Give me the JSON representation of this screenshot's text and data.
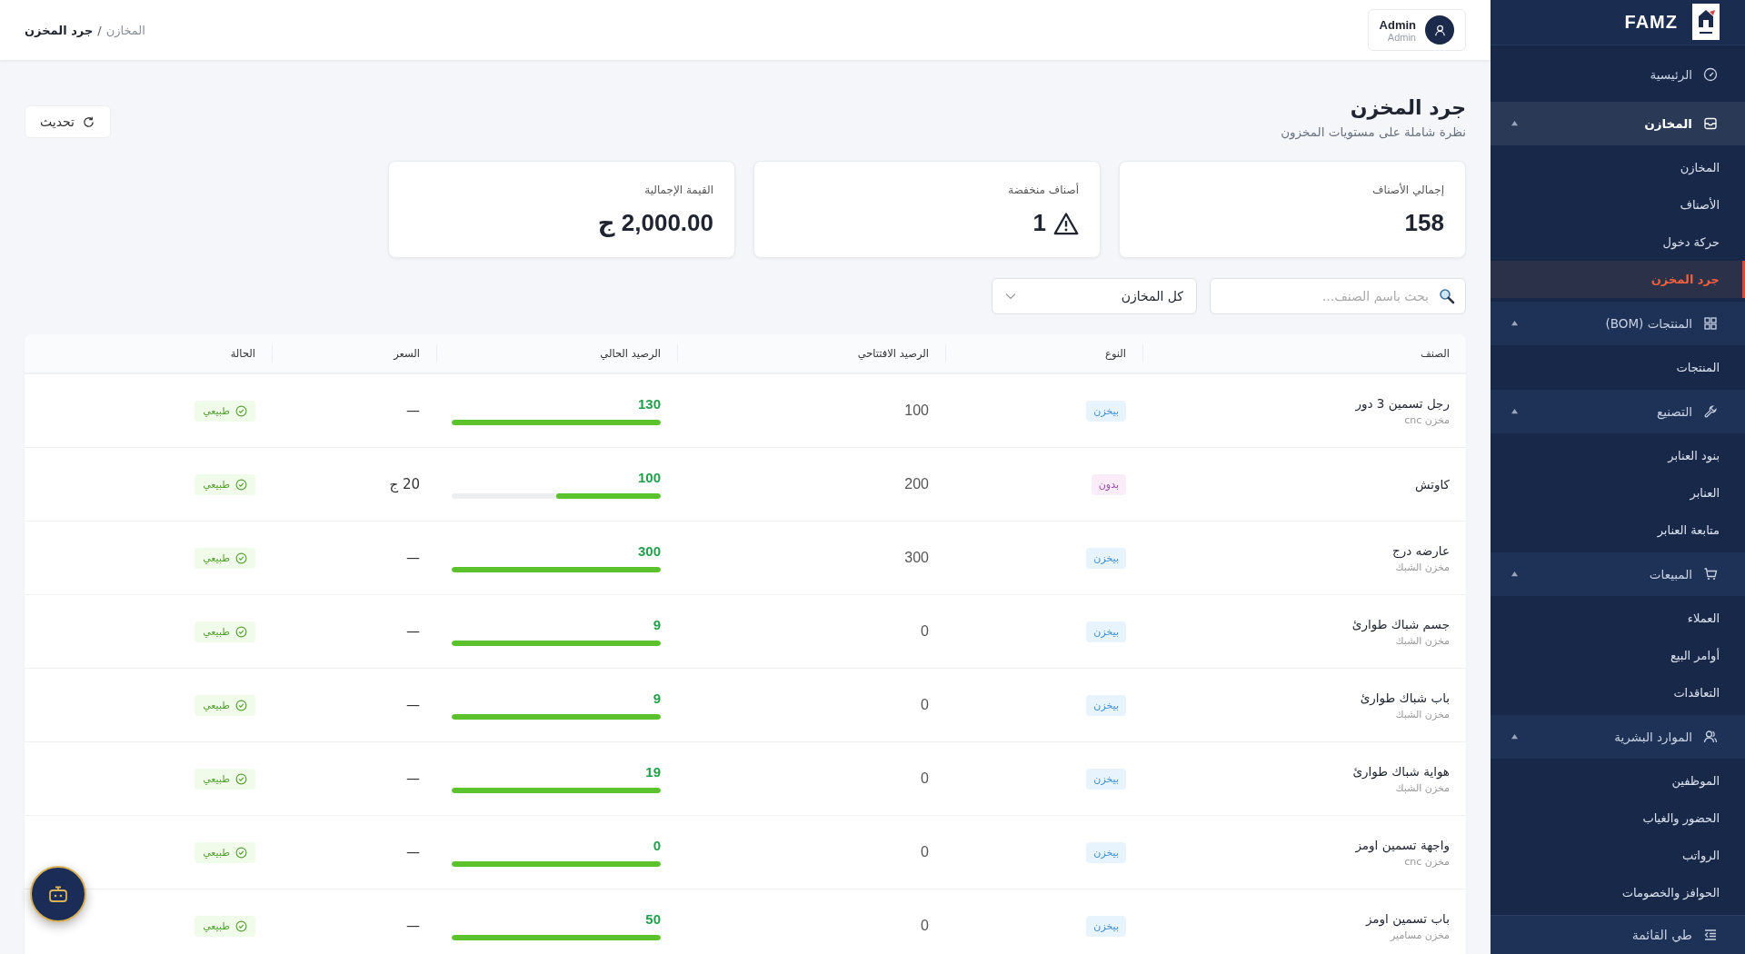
{
  "sidebar": {
    "brand": "FAMZ",
    "collapse_label": "طي القائمة",
    "items": [
      {
        "kind": "link",
        "label": "الرئيسية",
        "selected": false
      },
      {
        "kind": "group",
        "label": "المخازن",
        "expanded": true,
        "selected": true,
        "children": [
          {
            "label": "المخازن",
            "selected": false
          },
          {
            "label": "الأصناف",
            "selected": false
          },
          {
            "label": "حركة دخول",
            "selected": false
          },
          {
            "label": "جرد المخزن",
            "selected": true
          }
        ]
      },
      {
        "kind": "group",
        "label": "المنتجات (BOM)",
        "expanded": true,
        "selected": false,
        "children": [
          {
            "label": "المنتجات",
            "selected": false
          }
        ]
      },
      {
        "kind": "group",
        "label": "التصنيع",
        "expanded": true,
        "selected": false,
        "children": [
          {
            "label": "بنود العنابر",
            "selected": false
          },
          {
            "label": "العنابر",
            "selected": false
          },
          {
            "label": "متابعة العنابر",
            "selected": false
          }
        ]
      },
      {
        "kind": "group",
        "label": "المبيعات",
        "expanded": true,
        "selected": false,
        "children": [
          {
            "label": "العملاء",
            "selected": false
          },
          {
            "label": "أوامر البيع",
            "selected": false
          },
          {
            "label": "التعاقدات",
            "selected": false
          }
        ]
      },
      {
        "kind": "group",
        "label": "الموارد البشرية",
        "expanded": true,
        "selected": false,
        "children": [
          {
            "label": "الموظفين",
            "selected": false
          },
          {
            "label": "الحضور والغياب",
            "selected": false
          },
          {
            "label": "الرواتب",
            "selected": false
          },
          {
            "label": "الحوافز والخصومات",
            "selected": false
          }
        ]
      }
    ]
  },
  "topbar": {
    "breadcrumb": [
      {
        "label": "المخازن",
        "current": false
      },
      {
        "label": "جرد المخزن",
        "current": true
      }
    ],
    "separator": "/",
    "user": {
      "name": "Admin",
      "role": "Admin"
    }
  },
  "page": {
    "title": "جرد المخزن",
    "subtitle": "نظرة شاملة على مستويات المخزون",
    "refresh_button": "تحديث"
  },
  "stats": [
    {
      "label": "إجمالي الأصناف",
      "value": "158",
      "kind": "plain"
    },
    {
      "label": "أصناف منخفضة",
      "value": "1",
      "kind": "warning"
    },
    {
      "label": "القيمة الإجمالية",
      "value": "2,000.00 ج",
      "kind": "plain"
    }
  ],
  "filters": {
    "search": {
      "placeholder": "بحث باسم الصنف..."
    },
    "warehouse": {
      "value": "كل المخازن"
    }
  },
  "table": {
    "columns": [
      "الصنف",
      "النوع",
      "الرصيد الافتتاحي",
      "الرصيد الحالي",
      "السعر",
      "الحالة"
    ],
    "rows": [
      {
        "name": "رجل تسمين 3 دور",
        "warehouse": "مخزن cnc",
        "type": {
          "label": "بيخزن",
          "kind": "stock"
        },
        "opening": "100",
        "current": "130",
        "level": 1,
        "price": "—",
        "status": {
          "label": "طبيعي",
          "kind": "normal"
        }
      },
      {
        "name": "كاوتش",
        "type": {
          "label": "بدون",
          "kind": "none"
        },
        "opening": "200",
        "current": "100",
        "level": 0.5,
        "price": "20 ج",
        "status": {
          "label": "طبيعي",
          "kind": "normal"
        }
      },
      {
        "name": "عارضه درج",
        "warehouse": "مخزن الشبك",
        "type": {
          "label": "بيخزن",
          "kind": "stock"
        },
        "opening": "300",
        "current": "300",
        "level": 1,
        "price": "—",
        "status": {
          "label": "طبيعي",
          "kind": "normal"
        }
      },
      {
        "name": "جسم شباك طوارئ",
        "warehouse": "مخزن الشبك",
        "type": {
          "label": "بيخزن",
          "kind": "stock"
        },
        "opening": "0",
        "current": "9",
        "level": 1,
        "price": "—",
        "status": {
          "label": "طبيعي",
          "kind": "normal"
        }
      },
      {
        "name": "باب شباك طوارئ",
        "warehouse": "مخزن الشبك",
        "type": {
          "label": "بيخزن",
          "kind": "stock"
        },
        "opening": "0",
        "current": "9",
        "level": 1,
        "price": "—",
        "status": {
          "label": "طبيعي",
          "kind": "normal"
        }
      },
      {
        "name": "هواية شباك طوارئ",
        "warehouse": "مخزن الشبك",
        "type": {
          "label": "بيخزن",
          "kind": "stock"
        },
        "opening": "0",
        "current": "19",
        "level": 1,
        "price": "—",
        "status": {
          "label": "طبيعي",
          "kind": "normal"
        }
      },
      {
        "name": "واجهة تسمين اومز",
        "warehouse": "مخزن cnc",
        "type": {
          "label": "بيخزن",
          "kind": "stock"
        },
        "opening": "0",
        "current": "0",
        "level": 1,
        "price": "—",
        "status": {
          "label": "طبيعي",
          "kind": "normal"
        }
      },
      {
        "name": "باب تسمين اومز",
        "warehouse": "مخزن مسامير",
        "type": {
          "label": "بيخزن",
          "kind": "stock"
        },
        "opening": "0",
        "current": "50",
        "level": 1,
        "price": "—",
        "status": {
          "label": "طبيعي",
          "kind": "normal"
        }
      }
    ]
  }
}
